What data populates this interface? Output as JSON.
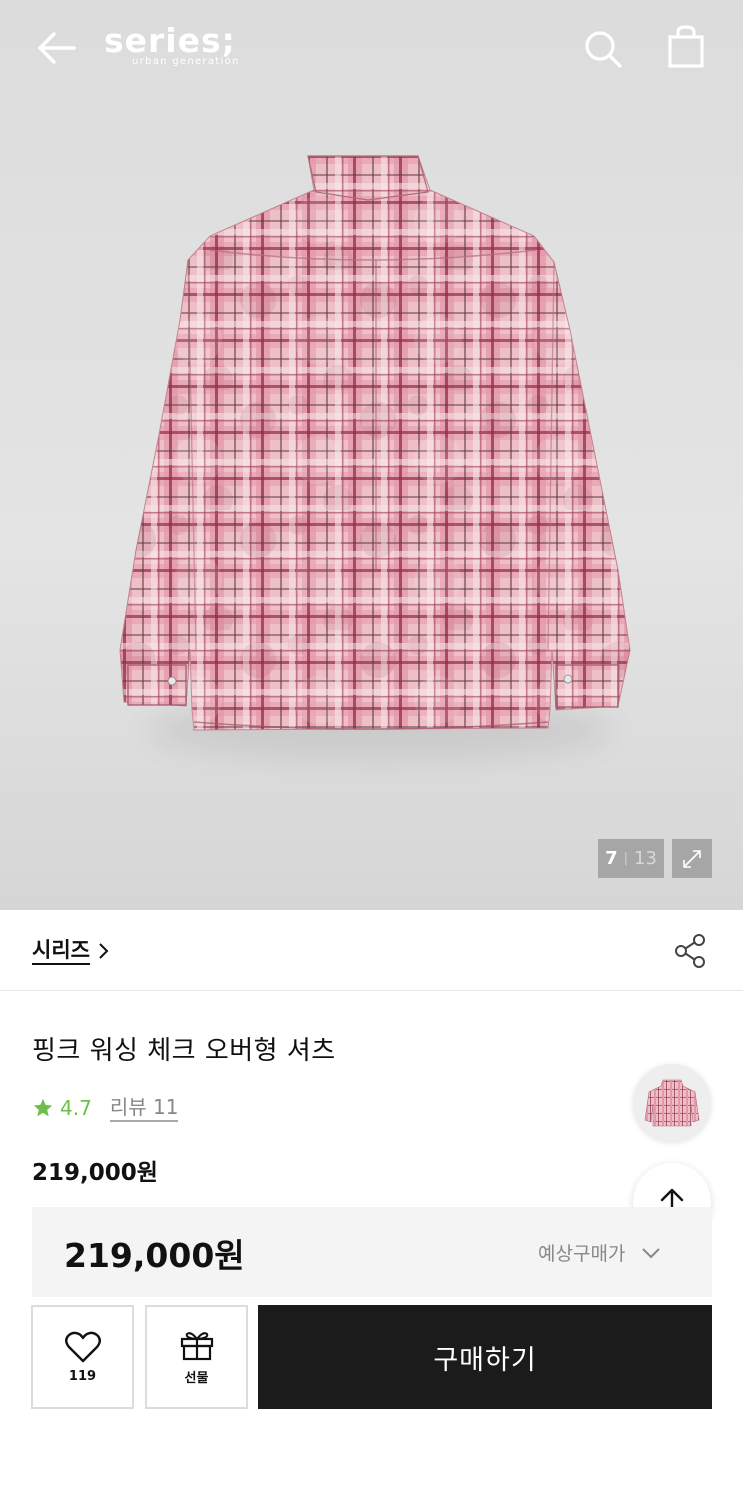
{
  "header": {
    "logo_text": "series;",
    "logo_tagline": "urban generation",
    "back_icon": "arrow-left-icon",
    "search_icon": "search-icon",
    "bag_icon": "shopping-bag-icon"
  },
  "gallery": {
    "current": "7",
    "separator": "|",
    "total": "13",
    "expand_icon": "expand-icon"
  },
  "brand": {
    "name": "시리즈",
    "chevron": "›",
    "share_icon": "share-icon"
  },
  "product": {
    "title": "핑크 워싱 체크 오버형 셔츠",
    "rating": "4.7",
    "rating_star": "★",
    "reviews_label": "리뷰 11",
    "price": "219,000원"
  },
  "price_bar": {
    "price": "219,000원",
    "estimate_label": "예상구매가"
  },
  "actions": {
    "like_count": "119",
    "gift_label": "선물",
    "buy_label": "구매하기"
  },
  "colors": {
    "rating_green": "#6cc04a",
    "buy_button": "#1b1b1b",
    "shirt_pink": "#e9a7b3",
    "shirt_wine": "#8e2f48"
  }
}
